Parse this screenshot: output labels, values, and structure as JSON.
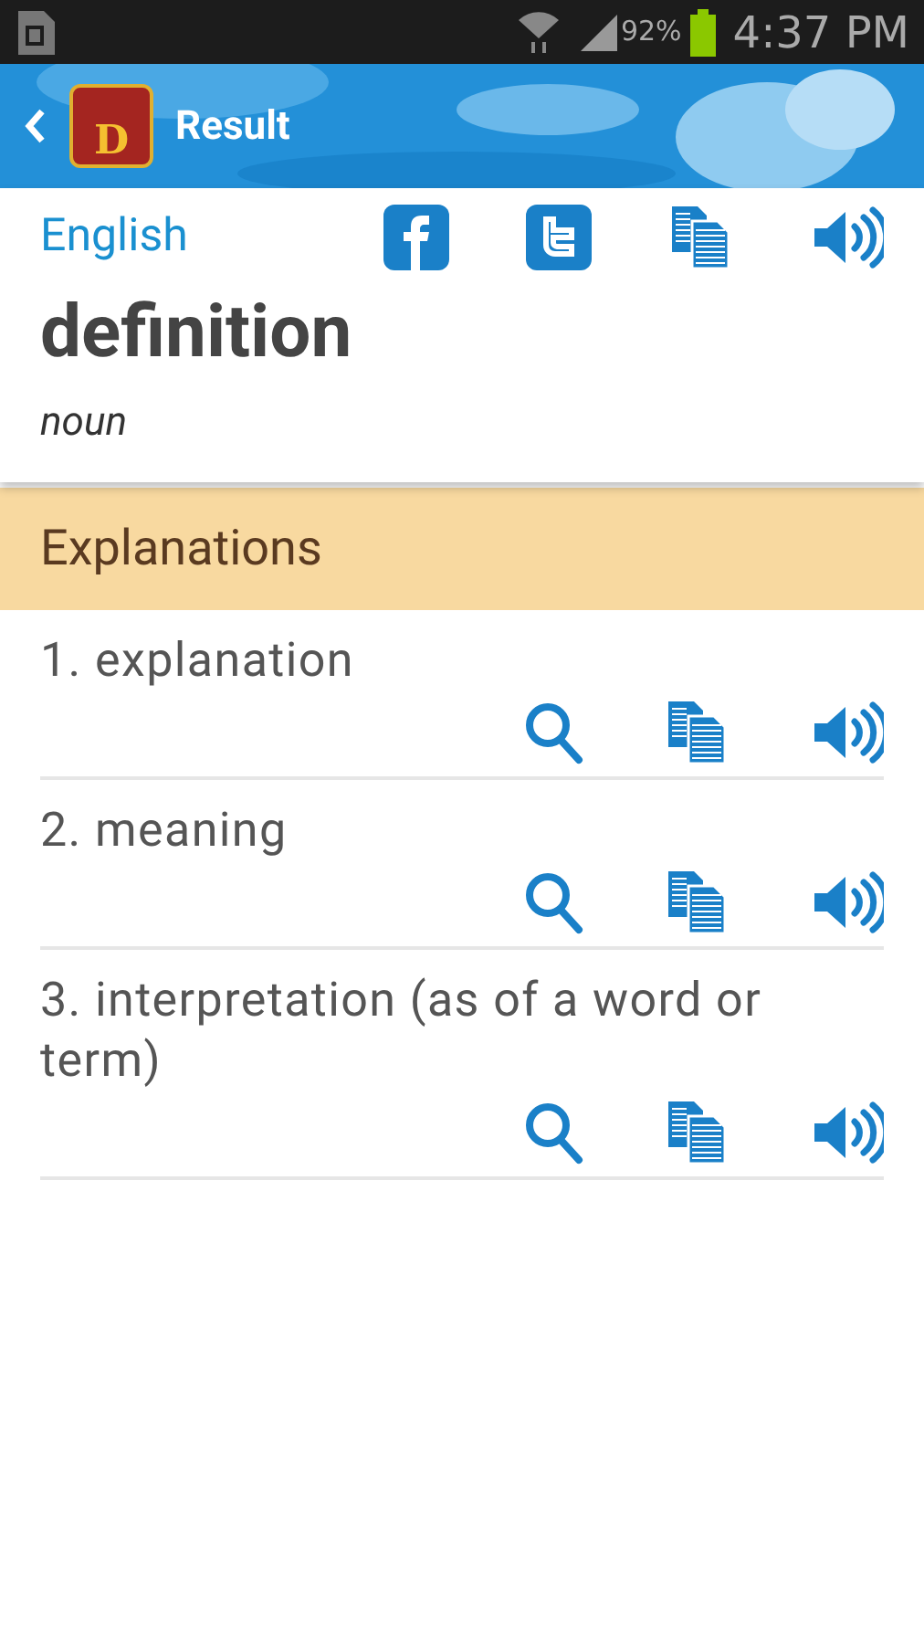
{
  "status_bar": {
    "battery": "92%",
    "time": "4:37 PM"
  },
  "header": {
    "title": "Result",
    "app_icon_letter": "D"
  },
  "entry": {
    "language": "English",
    "word": "definition",
    "part_of_speech": "noun"
  },
  "section": {
    "title": "Explanations"
  },
  "explanations": [
    {
      "text": "1. explanation"
    },
    {
      "text": "2. meaning"
    },
    {
      "text": "3. interpretation (as of a word or term)"
    }
  ]
}
